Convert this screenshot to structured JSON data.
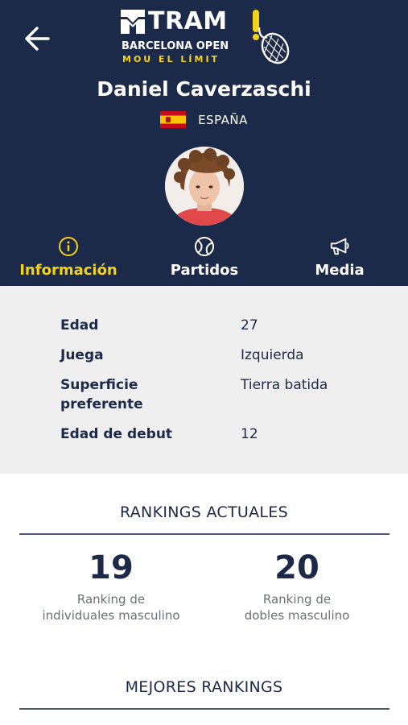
{
  "brand": {
    "name": "TRAM",
    "event": "BARCELONA OPEN",
    "tagline": "MOU EL LÍMIT",
    "accent_color": "#f5d21a",
    "navy_color": "#1c2a4a"
  },
  "header": {
    "back_icon": "arrow-left-icon",
    "player_name": "Daniel Caverzaschi",
    "country": "ESPAÑA",
    "flag": "spain-flag"
  },
  "tabs": [
    {
      "label": "Información",
      "icon": "info-circle-icon",
      "active": true
    },
    {
      "label": "Partidos",
      "icon": "tennis-ball-icon",
      "active": false
    },
    {
      "label": "Media",
      "icon": "megaphone-icon",
      "active": false
    }
  ],
  "info": [
    {
      "key": "Edad",
      "value": "27"
    },
    {
      "key": "Juega",
      "value": "Izquierda"
    },
    {
      "key": "Superficie preferente",
      "value": "Tierra batida"
    },
    {
      "key": "Edad de debut",
      "value": "12"
    }
  ],
  "rankings_current": {
    "title": "RANKINGS ACTUALES",
    "singles": {
      "value": "19",
      "label": "Ranking de individuales masculino"
    },
    "doubles": {
      "value": "20",
      "label": "Ranking de dobles masculino"
    }
  },
  "rankings_best": {
    "title": "MEJORES RANKINGS"
  }
}
